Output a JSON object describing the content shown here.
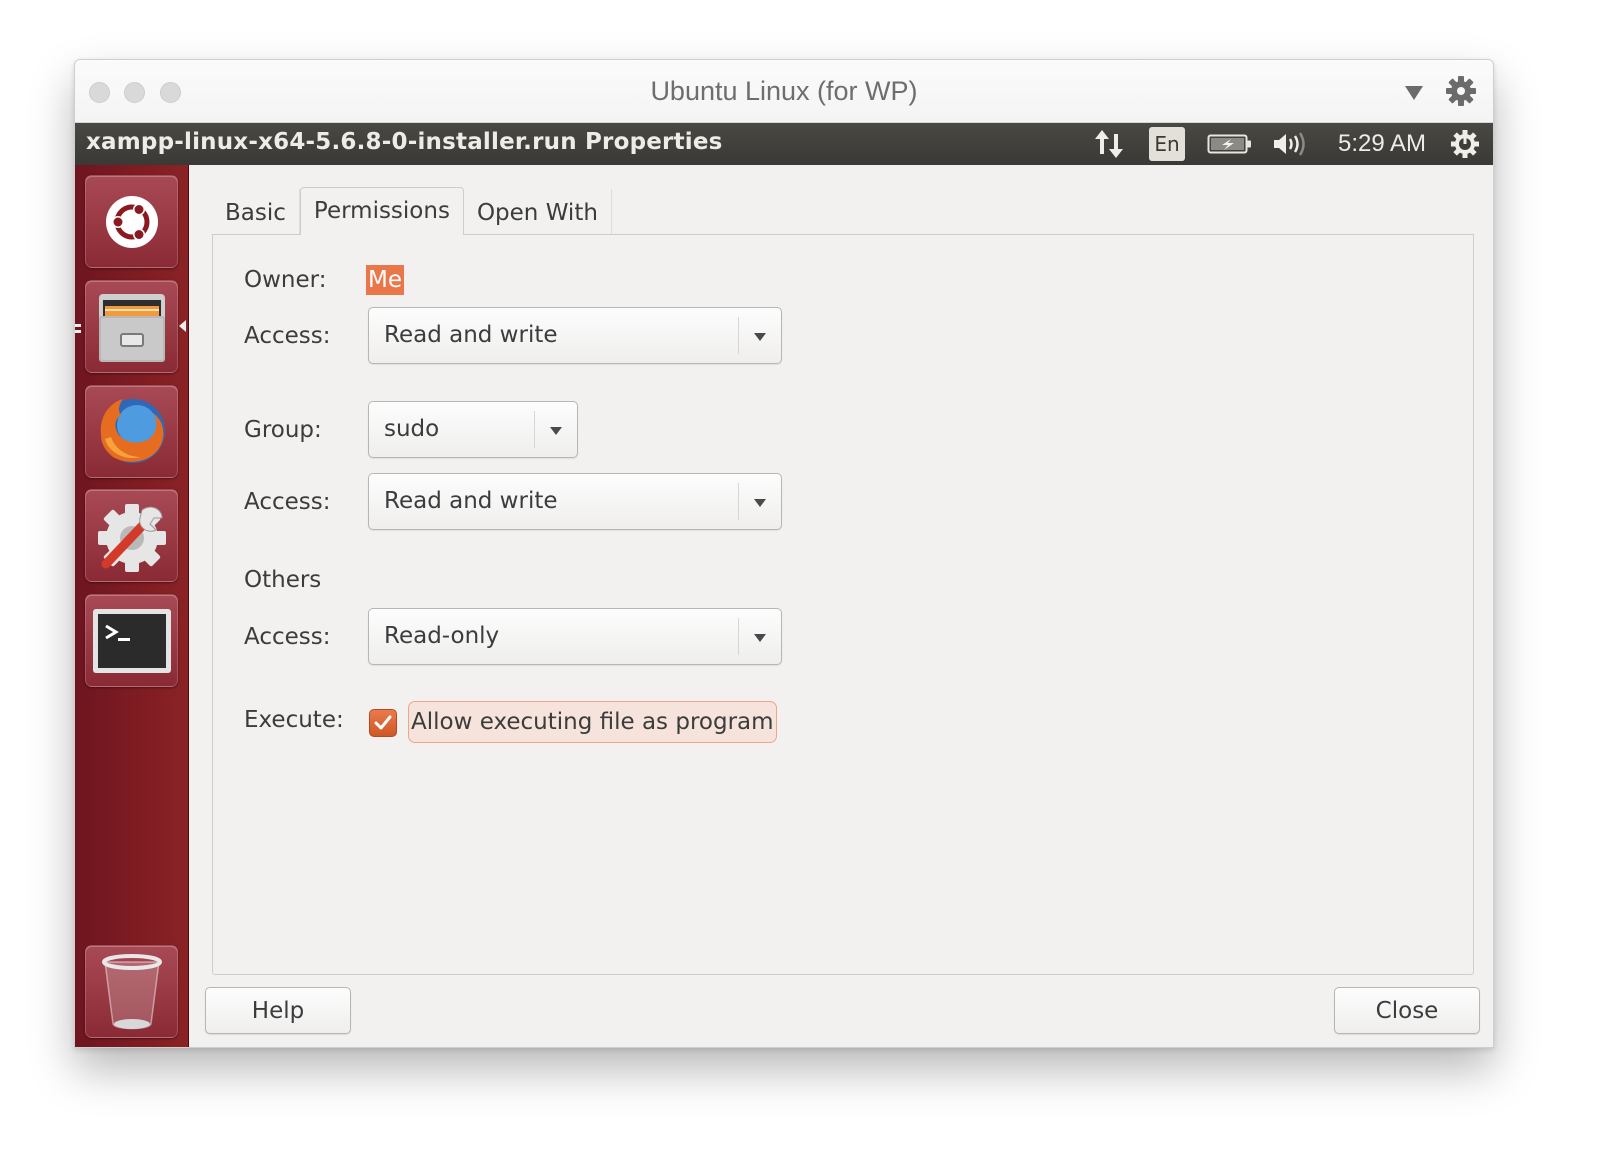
{
  "vm_window": {
    "title": "Ubuntu Linux (for WP)",
    "controls": [
      "close",
      "minimize",
      "zoom"
    ],
    "right_icons": [
      "dropdown-icon",
      "gear-icon"
    ]
  },
  "top_panel": {
    "window_title": "xampp-linux-x64-5.6.8-0-installer.run Properties",
    "indicators": {
      "network": "network-updown-icon",
      "keyboard_layout": "En",
      "battery": "battery-charging-icon",
      "volume": "volume-icon",
      "clock": "5:29 AM",
      "session": "power-gear-icon"
    }
  },
  "launcher": {
    "items": [
      {
        "name": "dash-home",
        "icon": "ubuntu-logo-icon"
      },
      {
        "name": "files",
        "icon": "file-cabinet-icon",
        "running": true,
        "focused": true
      },
      {
        "name": "firefox",
        "icon": "firefox-icon"
      },
      {
        "name": "system-settings",
        "icon": "settings-wrench-icon"
      },
      {
        "name": "terminal",
        "icon": "terminal-icon"
      },
      {
        "name": "trash",
        "icon": "trash-icon"
      }
    ]
  },
  "dialog": {
    "tabs": [
      {
        "label": "Basic",
        "active": false
      },
      {
        "label": "Permissions",
        "active": true
      },
      {
        "label": "Open With",
        "active": false
      }
    ],
    "permissions": {
      "owner_label": "Owner:",
      "owner_value": "Me",
      "owner_access_label": "Access:",
      "owner_access_value": "Read and write",
      "group_label": "Group:",
      "group_value": "sudo",
      "group_access_label": "Access:",
      "group_access_value": "Read and write",
      "others_label": "Others",
      "others_access_label": "Access:",
      "others_access_value": "Read-only",
      "execute_label": "Execute:",
      "execute_checkbox_label": "Allow executing file as program",
      "execute_checked": true
    },
    "buttons": {
      "help": "Help",
      "close": "Close"
    }
  },
  "colors": {
    "accent_orange": "#e9774a",
    "launcher_red": "#7e1c22",
    "panel_dark": "#3f3e3a",
    "dialog_bg": "#f2f1f0"
  }
}
